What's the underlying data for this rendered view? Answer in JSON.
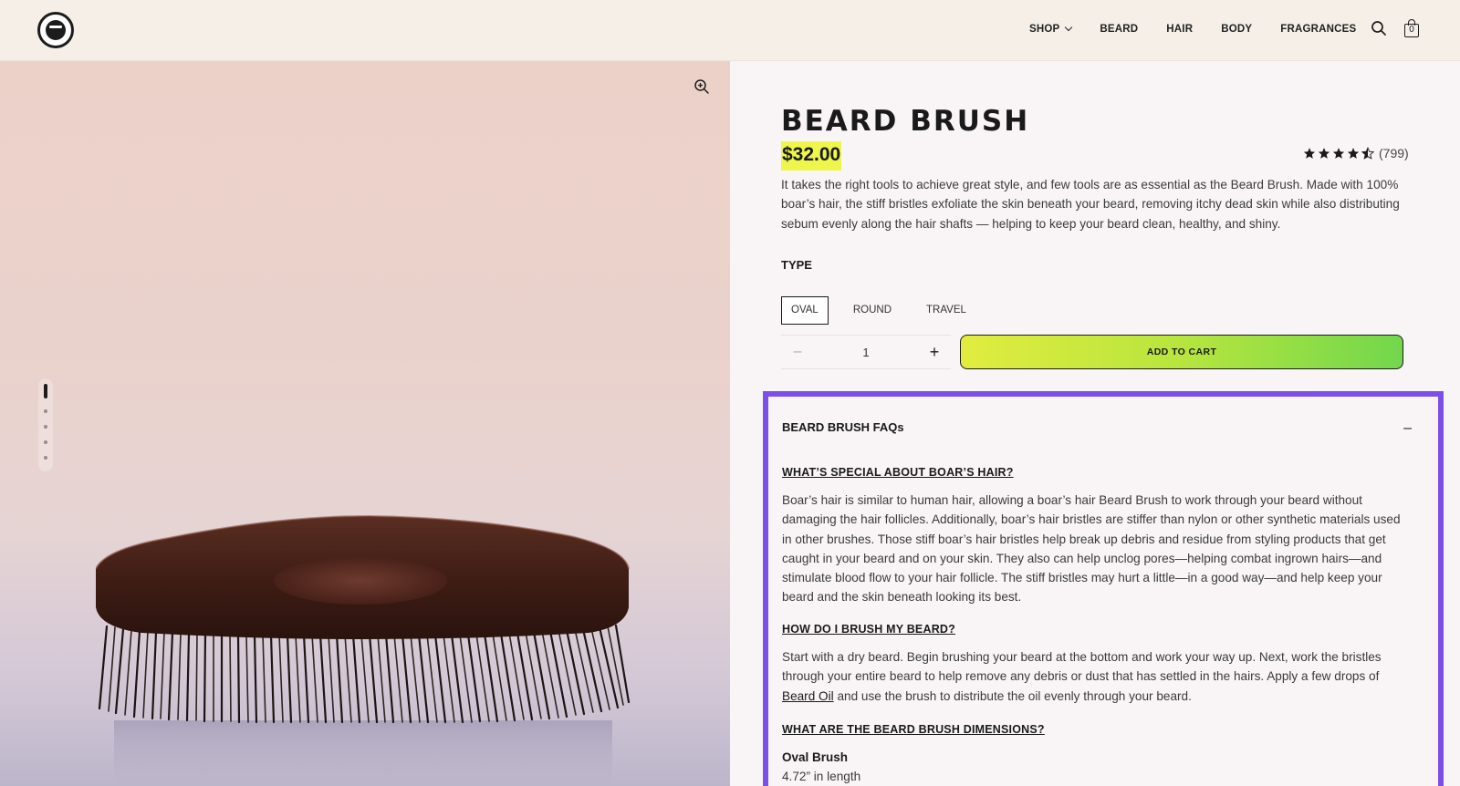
{
  "header": {
    "nav": [
      "SHOP",
      "BEARD",
      "HAIR",
      "BODY",
      "FRAGRANCES"
    ],
    "cart_count": "0"
  },
  "product": {
    "title": "BEARD BRUSH",
    "price": "$32.00",
    "rating_value": 4.5,
    "rating_count": "(799)",
    "description": "It takes the right tools to achieve great style, and few tools are as essential as the Beard Brush. Made with 100% boar’s hair, the stiff bristles exfoliate the skin beneath your beard, removing itchy dead skin while also distributing sebum evenly along the hair shafts — helping to keep your beard clean, healthy, and shiny.",
    "type_label": "TYPE",
    "variants": [
      "OVAL",
      "ROUND",
      "TRAVEL"
    ],
    "selected_variant": "OVAL",
    "quantity": "1",
    "qty_minus": "–",
    "qty_plus": "+",
    "add_to_cart": "ADD TO CART"
  },
  "gallery": {
    "image_count": 5,
    "active_index": 1
  },
  "faq": {
    "title": "BEARD BRUSH FAQs",
    "toggle": "–",
    "items": [
      {
        "question": "WHAT’S SPECIAL ABOUT BOAR’S HAIR?",
        "answer": "Boar’s hair is similar to human hair, allowing a boar’s hair Beard Brush to work through your beard without damaging the hair follicles. Additionally, boar’s hair bristles are stiffer than nylon or other synthetic materials used in other brushes. Those stiff boar’s hair bristles help break up debris and residue from styling products that get caught in your beard and on your skin. They also can help unclog pores—helping combat ingrown hairs—and stimulate blood flow to your hair follicle. The stiff bristles may hurt a little—in a good way—and help keep your beard and the skin beneath looking its best."
      },
      {
        "question": "HOW DO I BRUSH MY BEARD?",
        "answer_before_link": "Start with a dry beard. Begin brushing your beard at the bottom and work your way up. Next, work the bristles through your entire beard to help remove any debris or dust that has settled in the hairs. Apply a few drops of ",
        "answer_link": "Beard Oil",
        "answer_after_link": " and use the brush to distribute the oil evenly through your beard."
      },
      {
        "question": "WHAT ARE THE BEARD BRUSH DIMENSIONS?",
        "sub_title": "Oval Brush",
        "sub_line": "4.72” in length"
      }
    ]
  },
  "colors": {
    "accent_purple": "#7b4fe8",
    "price_highlight": "#eef54b",
    "button_gradient_start": "#e2ec3f",
    "button_gradient_end": "#72d74c"
  }
}
